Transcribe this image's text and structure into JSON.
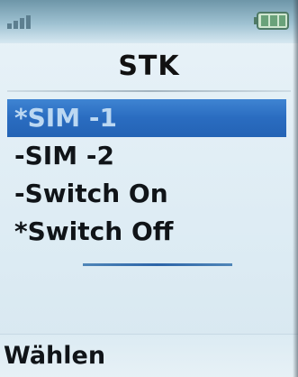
{
  "status_bar": {
    "signal_icon": "signal-strength-icon",
    "battery_icon": "battery-icon"
  },
  "header": {
    "title": "STK"
  },
  "menu": {
    "items": [
      {
        "label": "*SIM -1",
        "selected": true
      },
      {
        "label": "-SIM -2",
        "selected": false
      },
      {
        "label": "-Switch On",
        "selected": false
      },
      {
        "label": "*Switch Off",
        "selected": false
      }
    ]
  },
  "softkeys": {
    "left_label": "Wählen"
  },
  "colors": {
    "selection": "#2a6cc0",
    "selection_text": "#bcd8f2",
    "background": "#e3eff6",
    "header_bar": "#9fc2d2",
    "divider": "#2c64a8"
  }
}
